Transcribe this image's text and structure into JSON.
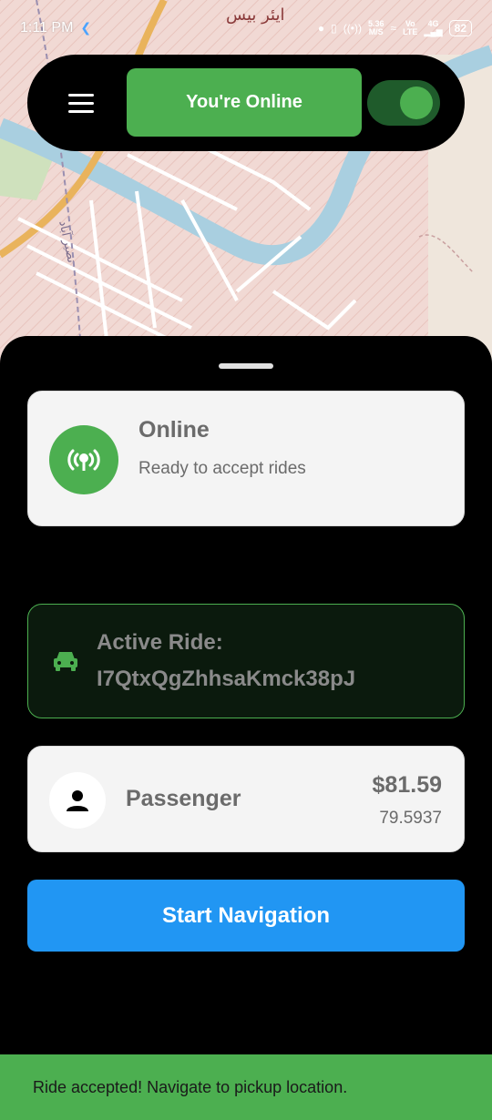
{
  "status_bar": {
    "time": "1:11 PM",
    "speed_value": "5.36",
    "speed_unit": "M/S",
    "vo": "Vo",
    "lte": "LTE",
    "net": "4G",
    "battery": "82"
  },
  "map": {
    "place_label": "ایئر بیس",
    "road_label": "نصیر آباد"
  },
  "top_bar": {
    "status_button_label": "You're Online",
    "toggle_on": true
  },
  "status_card": {
    "title": "Online",
    "subtitle": "Ready to accept rides"
  },
  "active_ride": {
    "label": "Active Ride:",
    "ride_id": "I7QtxQgZhhsaKmck38pJ"
  },
  "passenger": {
    "name": "Passenger",
    "price": "$81.59",
    "value": "79.5937"
  },
  "actions": {
    "start_navigation": "Start Navigation"
  },
  "snackbar": {
    "message": "Ride accepted! Navigate to pickup location."
  },
  "colors": {
    "accent_green": "#4caf50",
    "button_blue": "#2196f3",
    "map_water": "#a9cfe0"
  }
}
